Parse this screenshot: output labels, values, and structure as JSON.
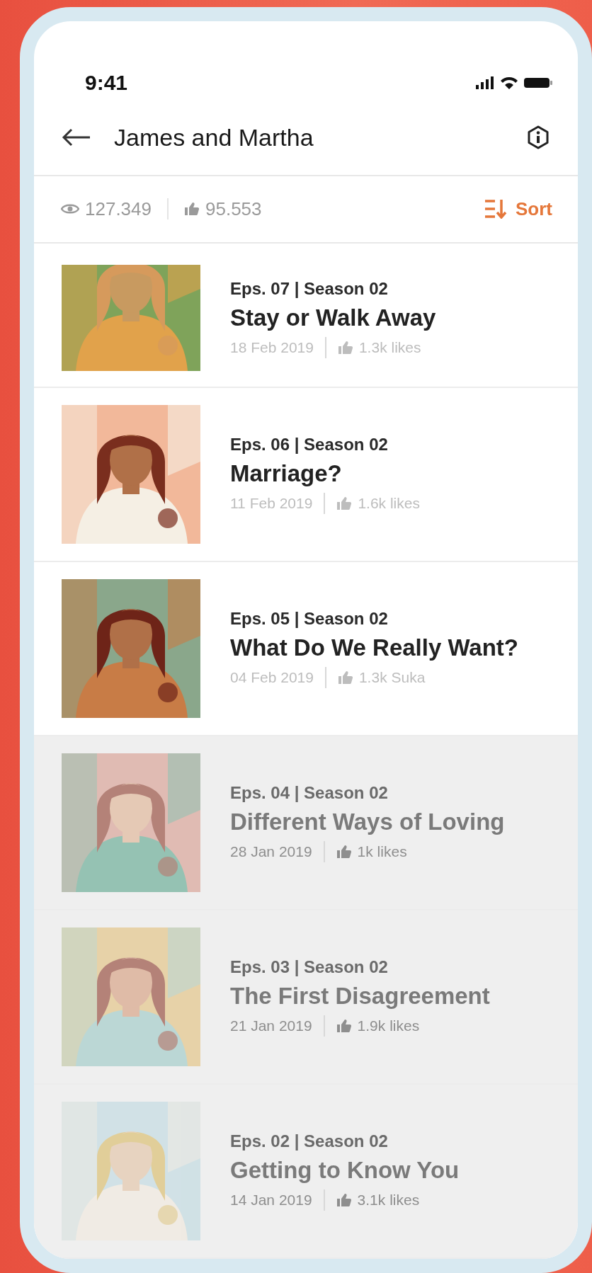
{
  "status_bar": {
    "time": "9:41"
  },
  "header": {
    "title": "James and Martha"
  },
  "stats": {
    "views": "127.349",
    "likes": "95.553",
    "sort_label": "Sort"
  },
  "episodes": [
    {
      "label": "Eps. 07 | Season 02",
      "title": "Stay or Walk Away",
      "date": "18 Feb 2019",
      "likes": "1.3k likes",
      "disabled": false
    },
    {
      "label": "Eps. 06 | Season 02",
      "title": "Marriage?",
      "date": "11 Feb 2019",
      "likes": "1.6k likes",
      "disabled": false
    },
    {
      "label": "Eps. 05 | Season 02",
      "title": "What Do We Really Want?",
      "date": "04 Feb 2019",
      "likes": "1.3k Suka",
      "disabled": false
    },
    {
      "label": "Eps. 04 | Season 02",
      "title": "Different Ways of Loving",
      "date": "28 Jan 2019",
      "likes": "1k likes",
      "disabled": true
    },
    {
      "label": "Eps. 03 | Season 02",
      "title": "The First Disagreement",
      "date": "21 Jan 2019",
      "likes": "1.9k likes",
      "disabled": true
    },
    {
      "label": "Eps. 02 | Season 02",
      "title": "Getting to Know You",
      "date": "14 Jan 2019",
      "likes": "3.1k likes",
      "disabled": true
    }
  ]
}
